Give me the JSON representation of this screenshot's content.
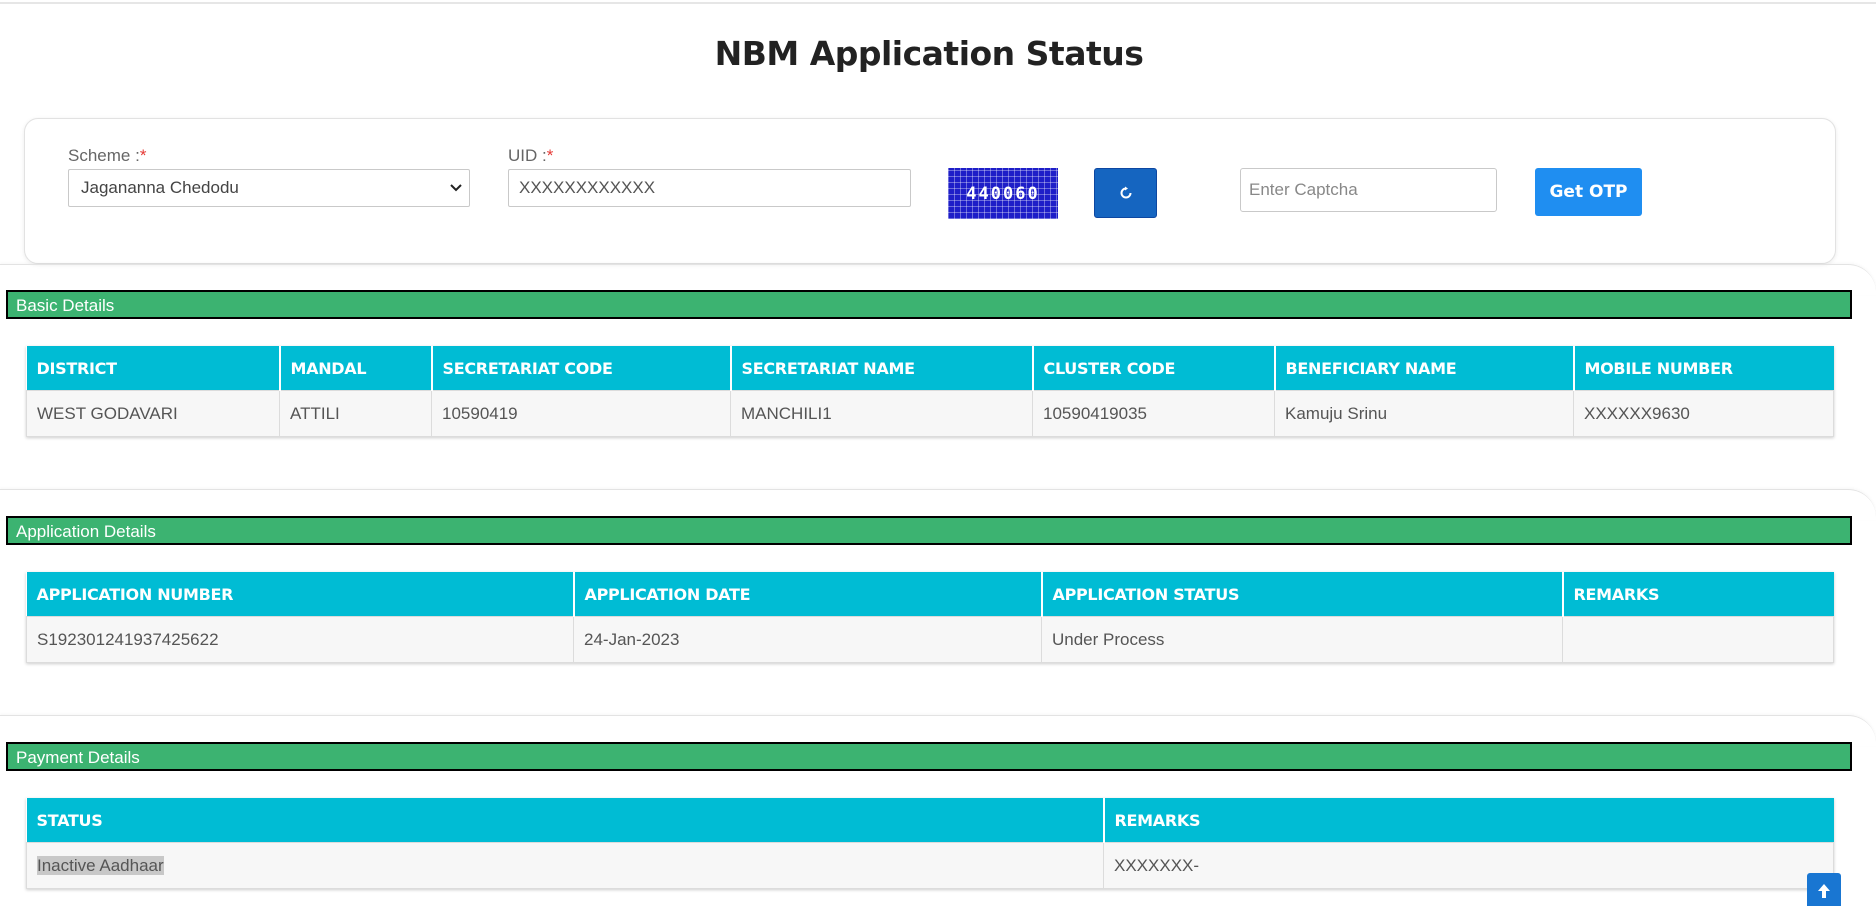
{
  "page": {
    "title": "NBM Application Status"
  },
  "form": {
    "scheme_label": "Scheme :",
    "scheme_value": "Jagananna Chedodu",
    "uid_label": "UID :",
    "uid_value": "XXXXXXXXXXXX",
    "required_mark": "*",
    "captcha_text": "440060",
    "captcha_placeholder": "Enter Captcha",
    "otp_button": "Get OTP"
  },
  "basic_details": {
    "title": "Basic Details",
    "headers": [
      "DISTRICT",
      "MANDAL",
      "SECRETARIAT CODE",
      "SECRETARIAT NAME",
      "CLUSTER CODE",
      "BENEFICIARY NAME",
      "MOBILE NUMBER"
    ],
    "row": [
      "WEST GODAVARI",
      "ATTILI",
      "10590419",
      "MANCHILI1",
      "10590419035",
      "Kamuju Srinu",
      "XXXXXX9630"
    ]
  },
  "application_details": {
    "title": "Application Details",
    "headers": [
      "APPLICATION NUMBER",
      "APPLICATION DATE",
      "APPLICATION STATUS",
      "REMARKS"
    ],
    "row": [
      "S192301241937425622",
      "24-Jan-2023",
      "Under Process",
      ""
    ]
  },
  "payment_details": {
    "title": "Payment Details",
    "headers": [
      "STATUS",
      "REMARKS"
    ],
    "row": [
      "Inactive Aadhaar",
      "XXXXXXX-"
    ]
  },
  "colors": {
    "section_bar": "#3cb371",
    "table_header": "#00bcd4",
    "button": "#1f8ef1"
  }
}
